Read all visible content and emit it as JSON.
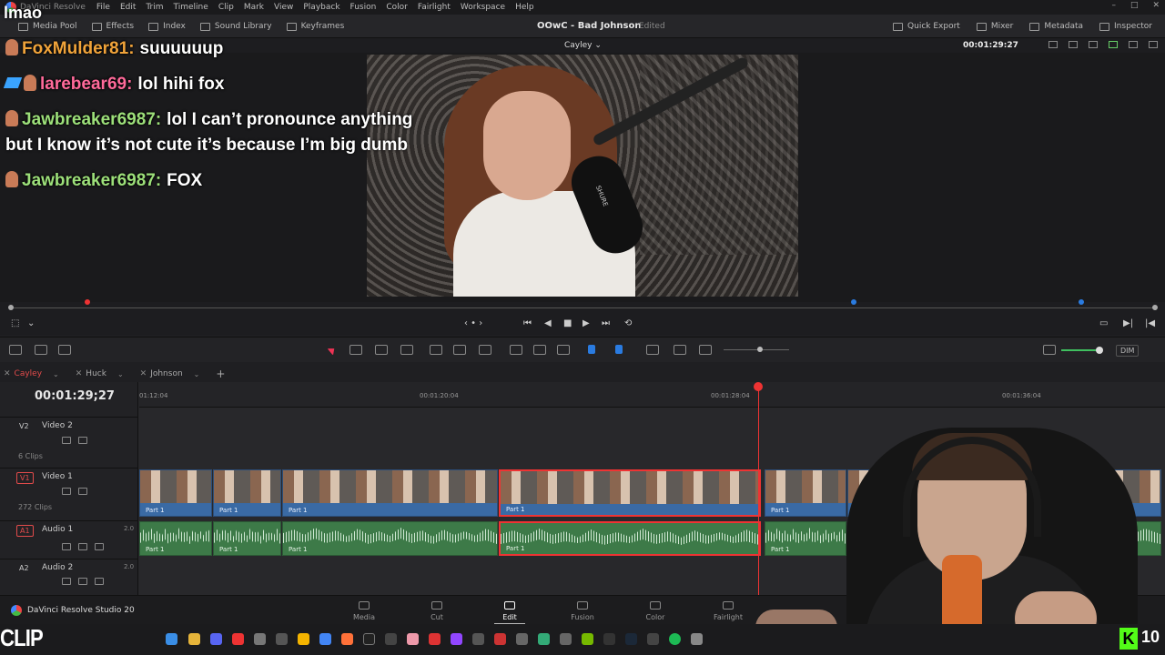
{
  "app": {
    "name": "DaVinci Resolve",
    "menu": [
      "File",
      "Edit",
      "Trim",
      "Timeline",
      "Clip",
      "Mark",
      "View",
      "Playback",
      "Fusion",
      "Color",
      "Fairlight",
      "Workspace",
      "Help"
    ]
  },
  "toolbar": {
    "left": [
      "Media Pool",
      "Effects",
      "Index",
      "Sound Library",
      "Keyframes"
    ],
    "project_title": "OOwC - Bad Johnson",
    "edited_label": "Edited",
    "right": [
      "Quick Export",
      "Mixer",
      "Metadata",
      "Inspector"
    ]
  },
  "viewer": {
    "clip_name": "Cayley",
    "timecode": "00:01:29:27"
  },
  "overlay": {
    "watermark": "lmao",
    "chat": [
      {
        "user": "FoxMulder81:",
        "color": "#f0a33a",
        "text": "suuuuuup"
      },
      {
        "user": "larebear69:",
        "color": "#ff6a9a",
        "text": "lol hihi fox"
      },
      {
        "user": "Jawbreaker6987:",
        "color": "#9de07a",
        "text": "lol I can’t pronounce anything",
        "text2": "but I know it’s not cute it’s because I’m big dumb"
      },
      {
        "user": "Jawbreaker6987:",
        "color": "#9de07a",
        "text": "FOX"
      }
    ],
    "mic_brand": "SHURE",
    "clip_logo": "CLIP",
    "kick_logo": "K",
    "kick_count": "10"
  },
  "edit_tools": {
    "dim_label": "DIM"
  },
  "timeline_tabs": [
    {
      "label": "Cayley",
      "active": true
    },
    {
      "label": "Huck",
      "active": false
    },
    {
      "label": "Johnson",
      "active": false
    }
  ],
  "timeline": {
    "timecode": "00:01:29;27",
    "ruler": [
      "01:12:04",
      "00:01:20:04",
      "00:01:28:04",
      "00:01:36:04"
    ],
    "tracks": {
      "v2": {
        "id": "V2",
        "name": "Video 2",
        "clips": "6 Clips"
      },
      "v1": {
        "id": "V1",
        "name": "Video 1",
        "clips": "272 Clips"
      },
      "a1": {
        "id": "A1",
        "name": "Audio 1",
        "level": "2.0"
      },
      "a2": {
        "id": "A2",
        "name": "Audio 2",
        "level": "2.0"
      }
    },
    "clip_label": "Part 1"
  },
  "pages": {
    "brand": "DaVinci Resolve Studio 20",
    "items": [
      "Media",
      "Cut",
      "Edit",
      "Fusion",
      "Color",
      "Fairlight"
    ],
    "active": "Edit"
  },
  "colors": {
    "playhead": "#e33333",
    "video_clip": "#3a6aa4",
    "audio_clip": "#3d7a48",
    "active_tab": "#e24b4b"
  }
}
